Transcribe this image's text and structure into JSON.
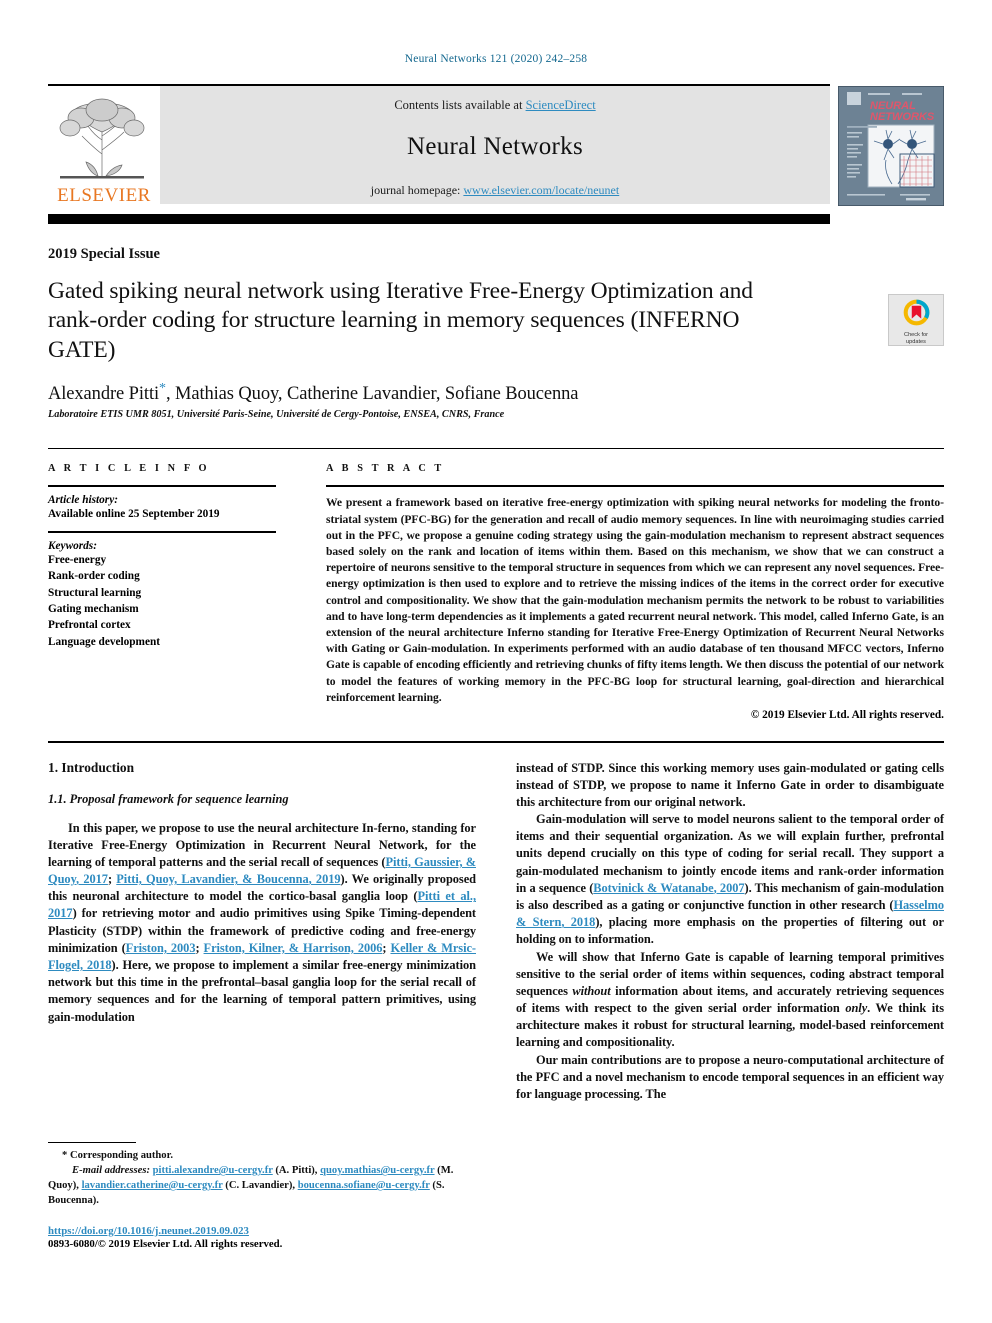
{
  "running_head": "Neural Networks 121 (2020) 242–258",
  "header": {
    "contents_prefix": "Contents lists available at ",
    "sciencedirect": "ScienceDirect",
    "journal_name": "Neural Networks",
    "homepage_prefix": "journal homepage: ",
    "homepage_url": "www.elsevier.com/locate/neunet",
    "publisher_wordmark": "ELSEVIER",
    "cover_title_line1": "NEURAL",
    "cover_title_line2": "NETWORKS",
    "link_color": "#2e8bc0",
    "elsevier_orange": "#e87722"
  },
  "crossmark": {
    "line1": "Check for",
    "line2": "updates"
  },
  "title_block": {
    "special_issue": "2019 Special Issue",
    "title": "Gated spiking neural network using Iterative Free-Energy Optimization and rank-order coding for structure learning in memory sequences (INFERNO GATE)",
    "authors": "Alexandre Pitti",
    "corresponding_star": "*",
    "authors_rest": ", Mathias Quoy, Catherine Lavandier, Sofiane Boucenna",
    "affiliation": "Laboratoire ETIS UMR 8051, Université Paris-Seine, Université de Cergy-Pontoise, ENSEA, CNRS, France"
  },
  "article_info": {
    "heading": "A R T I C L E   I N F O",
    "history_label": "Article history:",
    "history_value": "Available online 25 September 2019",
    "keywords_label": "Keywords:",
    "keywords": [
      "Free-energy",
      "Rank-order coding",
      "Structural learning",
      "Gating mechanism",
      "Prefrontal cortex",
      "Language development"
    ]
  },
  "abstract": {
    "heading": "A B S T R A C T",
    "text": "We present a framework based on iterative free-energy optimization with spiking neural networks for modeling the fronto-striatal system (PFC-BG) for the generation and recall of audio memory sequences. In line with neuroimaging studies carried out in the PFC, we propose a genuine coding strategy using the gain-modulation mechanism to represent abstract sequences based solely on the rank and location of items within them. Based on this mechanism, we show that we can construct a repertoire of neurons sensitive to the temporal structure in sequences from which we can represent any novel sequences. Free-energy optimization is then used to explore and to retrieve the missing indices of the items in the correct order for executive control and compositionality. We show that the gain-modulation mechanism permits the network to be robust to variabilities and to have long-term dependencies as it implements a gated recurrent neural network. This model, called Inferno Gate, is an extension of the neural architecture Inferno standing for Iterative Free-Energy Optimization of Recurrent Neural Networks with Gating or Gain-modulation. In experiments performed with an audio database of ten thousand MFCC vectors, Inferno Gate is capable of encoding efficiently and retrieving chunks of fifty items length. We then discuss the potential of our network to model the features of working memory in the PFC-BG loop for structural learning, goal-direction and hierarchical reinforcement learning.",
    "copyright": "© 2019 Elsevier Ltd. All rights reserved."
  },
  "body": {
    "section_number_title": "1. Introduction",
    "subsection_title": "1.1. Proposal framework for sequence learning",
    "left_para1_a": "In this paper, we propose to use the neural architecture In-ferno, standing for Iterative Free-Energy Optimization in Recurrent Neural Network, for the learning of temporal patterns and the serial recall of sequences (",
    "left_ref1": "Pitti, Gaussier, & Quoy",
    "left_ref1_year": ", 2017",
    "left_sep1": "; ",
    "left_ref2": "Pitti, Quoy, Lavandier, & Boucenna",
    "left_ref2_year": ", 2019",
    "left_para1_b": "). We originally proposed this neuronal architecture to model the cortico-basal ganglia loop (",
    "left_ref3": "Pitti et al., 2017",
    "left_para1_c": ") for retrieving motor and audio primitives using Spike Timing-dependent Plasticity (STDP) within the framework of predictive coding and free-energy minimization (",
    "left_ref4": "Friston, 2003",
    "left_sep2": "; ",
    "left_ref5": "Friston, Kilner, & Harrison, 2006",
    "left_sep3": "; ",
    "left_ref6": "Keller & Mrsic-Flogel, 2018",
    "left_para1_d": "). Here, we propose to implement a similar free-energy minimization network but this time in the prefrontal–basal ganglia loop for the serial recall of memory sequences and for the learning of temporal pattern primitives, using gain-modulation",
    "right_para1": "instead of STDP. Since this working memory uses gain-modulated or gating cells instead of STDP, we propose to name it Inferno Gate in order to disambiguate this architecture from our original network.",
    "right_para2_a": "Gain-modulation will serve to model neurons salient to the temporal order of items and their sequential organization. As we will explain further, prefrontal units depend crucially on this type of coding for serial recall. They support a gain-modulated mechanism to jointly encode items and rank-order information in a sequence (",
    "right_ref1": "Botvinick & Watanabe",
    "right_ref1_year": ", 2007",
    "right_para2_b": "). This mechanism of gain-modulation is also described as a gating or conjunctive function in other research (",
    "right_ref2": "Hasselmo & Stern",
    "right_ref2_year": ", 2018",
    "right_para2_c": "), placing more emphasis on the properties of filtering out or holding on to information.",
    "right_para3_a": "We will show that Inferno Gate is capable of learning temporal primitives sensitive to the serial order of items within sequences, coding abstract temporal sequences ",
    "right_para3_em": "without",
    "right_para3_b": " information about items, and accurately retrieving sequences of items with respect to the given serial order information ",
    "right_para3_em2": "only",
    "right_para3_c": ". We think its architecture makes it robust for structural learning, model-based reinforcement learning and compositionality.",
    "right_para4": "Our main contributions are to propose a neuro-computational architecture of the PFC and a novel mechanism to encode temporal sequences in an efficient way for language processing. The"
  },
  "footnote": {
    "corr_star": "*",
    "corr_text": "Corresponding author.",
    "email_label": "E-mail addresses:",
    "email1": "pitti.alexandre@u-cergy.fr",
    "email1_who": " (A. Pitti),",
    "email2": "quoy.mathias@u-cergy.fr",
    "email2_who": " (M. Quoy),",
    "email3": "lavandier.catherine@u-cergy.fr",
    "email3_who": "(C. Lavandier),",
    "email4": "boucenna.sofiane@u-cergy.fr",
    "email4_who": " (S. Boucenna).",
    "doi": "https://doi.org/10.1016/j.neunet.2019.09.023",
    "issn": "0893-6080/© 2019 Elsevier Ltd. All rights reserved."
  }
}
